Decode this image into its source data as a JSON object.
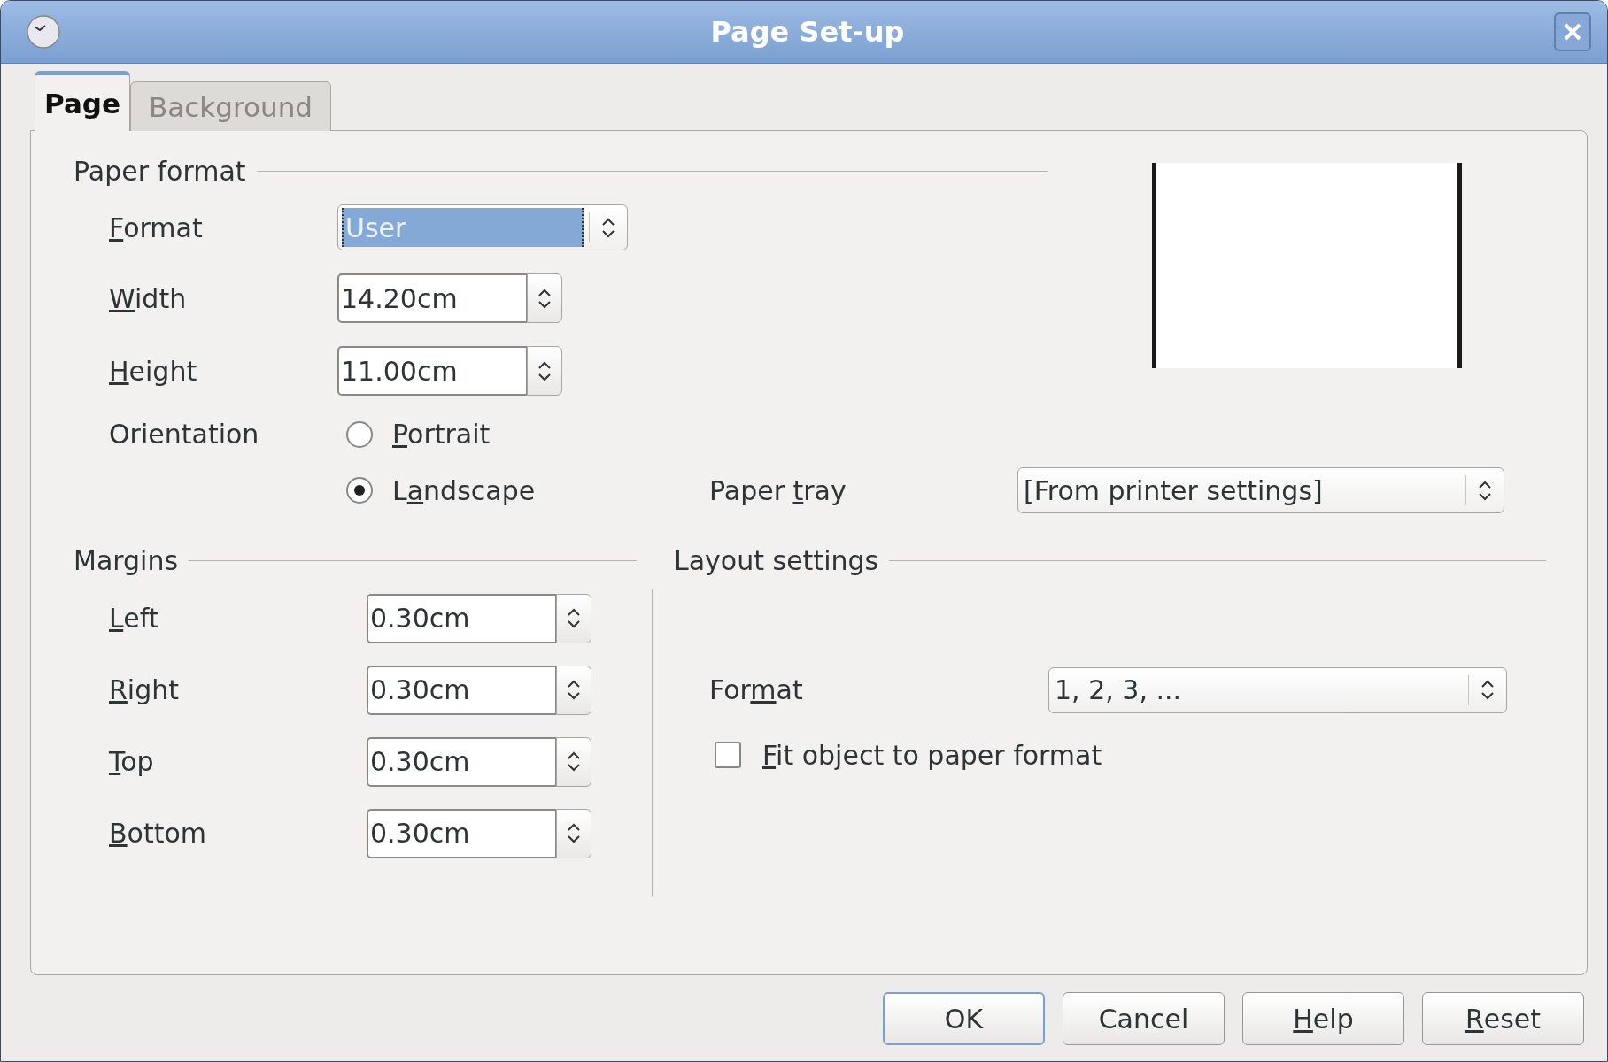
{
  "window": {
    "title": "Page Set-up"
  },
  "tabs": [
    {
      "label": "Page",
      "selected": true
    },
    {
      "label": "Background",
      "selected": false
    }
  ],
  "paper_format": {
    "heading": "Paper format",
    "format": {
      "label": {
        "key": "F",
        "post": "ormat"
      },
      "value": "User",
      "highlighted": true
    },
    "width": {
      "label": {
        "key": "W",
        "post": "idth"
      },
      "value": "14.20cm"
    },
    "height": {
      "label": {
        "key": "H",
        "post": "eight"
      },
      "value": "11.00cm"
    },
    "orientation": {
      "label": {
        "post": "Orientation"
      },
      "options": [
        {
          "label": {
            "key": "P",
            "post": "ortrait"
          },
          "selected": false
        },
        {
          "label": {
            "pre": "L",
            "key": "a",
            "post": "ndscape"
          },
          "selected": true
        }
      ]
    },
    "paper_tray": {
      "label": {
        "pre": "Paper ",
        "key": "t",
        "post": "ray"
      },
      "value": "[From printer settings]",
      "highlighted": false
    }
  },
  "margins": {
    "heading": "Margins",
    "fields": [
      {
        "label": {
          "key": "L",
          "post": "eft"
        },
        "value": "0.30cm"
      },
      {
        "label": {
          "key": "R",
          "post": "ight"
        },
        "value": "0.30cm"
      },
      {
        "label": {
          "key": "T",
          "post": "op"
        },
        "value": "0.30cm"
      },
      {
        "label": {
          "key": "B",
          "post": "ottom"
        },
        "value": "0.30cm"
      }
    ]
  },
  "layout_settings": {
    "heading": "Layout settings",
    "format": {
      "label": {
        "pre": "For",
        "key": "m",
        "post": "at"
      },
      "value": "1, 2, 3, ...",
      "highlighted": false
    },
    "fit_object": {
      "label": {
        "key": "F",
        "post": "it object to paper format"
      },
      "checked": false
    }
  },
  "buttons": [
    {
      "label": {
        "post": "OK"
      },
      "kind": "default"
    },
    {
      "label": {
        "post": "Cancel"
      },
      "kind": "normal"
    },
    {
      "label": {
        "key": "H",
        "post": "elp"
      },
      "kind": "normal"
    },
    {
      "label": {
        "key": "R",
        "post": "eset"
      },
      "kind": "normal"
    }
  ]
}
